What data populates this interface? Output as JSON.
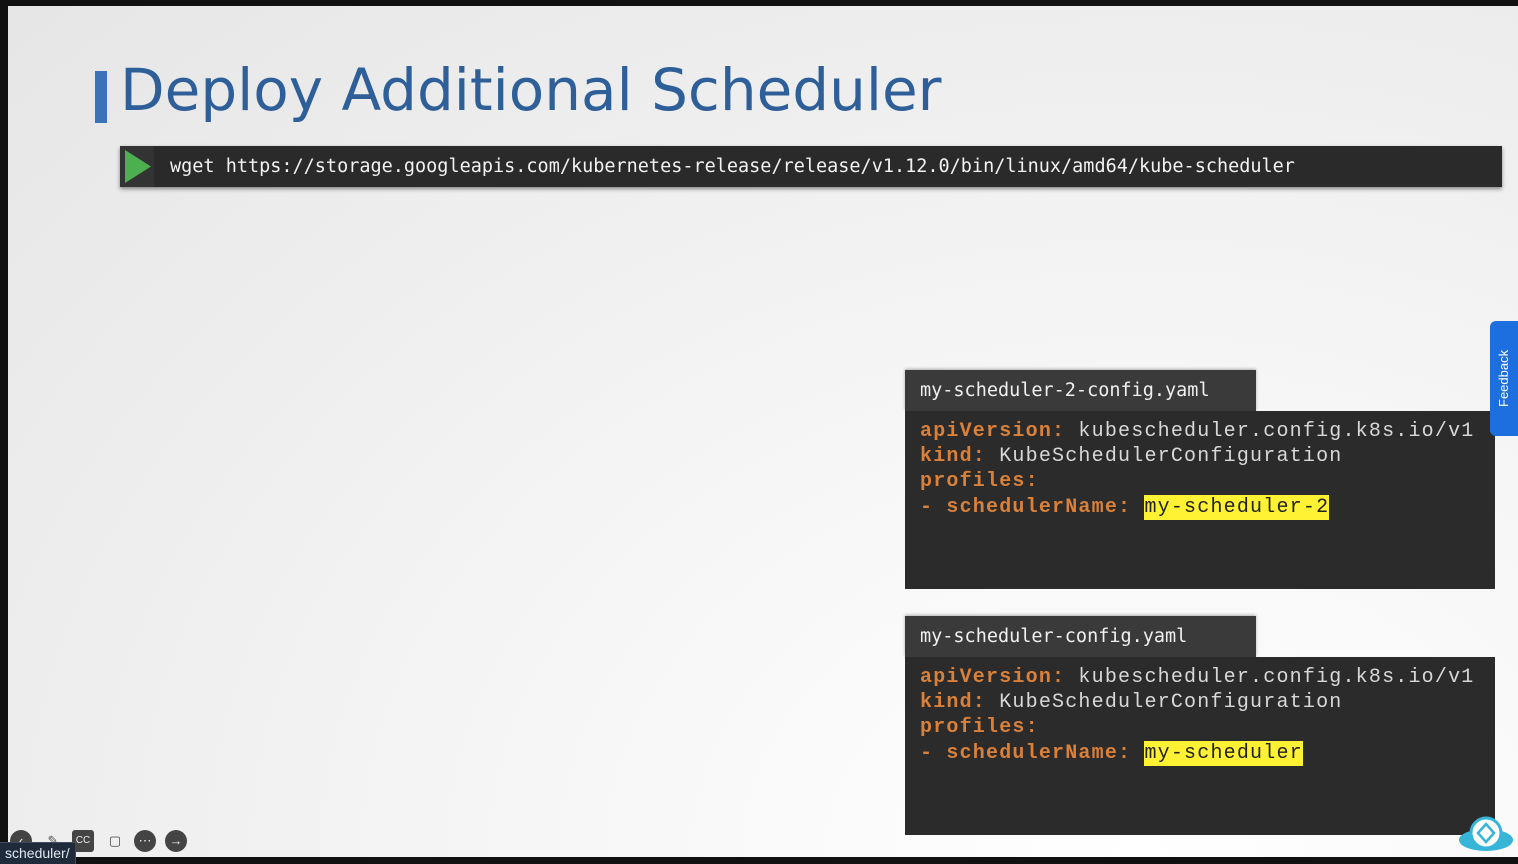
{
  "slide": {
    "title": "Deploy Additional Scheduler",
    "command": "wget https://storage.googleapis.com/kubernetes-release/release/v1.12.0/bin/linux/amd64/kube-scheduler"
  },
  "files": [
    {
      "filename": "my-scheduler-2-config.yaml",
      "lines": {
        "l1_key": "apiVersion:",
        "l1_val": " kubescheduler.config.k8s.io/v1",
        "l2_key": "kind:",
        "l2_val": " KubeSchedulerConfiguration",
        "l3_key": "profiles:",
        "l4_key": "- schedulerName:",
        "l4_val": "my-scheduler-2"
      }
    },
    {
      "filename": "my-scheduler-config.yaml",
      "lines": {
        "l1_key": "apiVersion:",
        "l1_val": " kubescheduler.config.k8s.io/v1",
        "l2_key": "kind:",
        "l2_val": " KubeSchedulerConfiguration",
        "l3_key": "profiles:",
        "l4_key": "- schedulerName:",
        "l4_val": "my-scheduler"
      }
    }
  ],
  "feedback": {
    "label": "Feedback"
  },
  "status_url": "scheduler/",
  "colors": {
    "title": "#2f5f99",
    "accent": "#3b73b9",
    "yaml_key": "#d9803a",
    "highlight": "#fff133",
    "play": "#4caf50"
  },
  "player_controls": [
    "back-icon",
    "pen-icon",
    "captions-icon",
    "camera-off-icon",
    "more-icon",
    "next-icon"
  ]
}
